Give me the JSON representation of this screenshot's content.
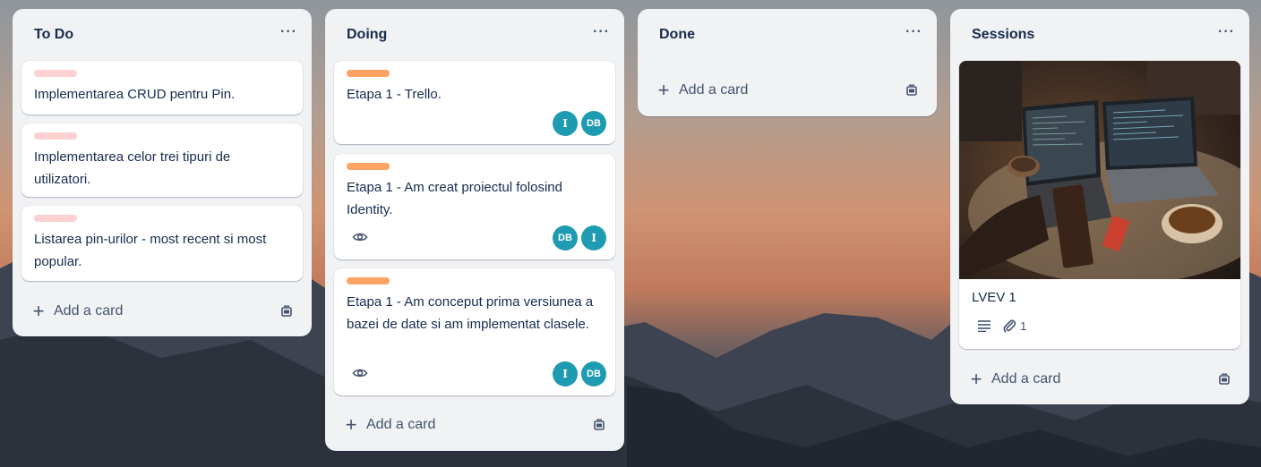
{
  "board": {
    "lists": [
      {
        "title": "To Do",
        "menu": "···",
        "cards": [
          {
            "text": "Implementarea CRUD pentru Pin.",
            "label_color": "#fdd0d2"
          },
          {
            "text": "Implementarea celor trei tipuri de utilizatori.",
            "label_color": "#fdd0d2"
          },
          {
            "text": "Listarea pin-urilor - most recent si most popular.",
            "label_color": "#fdd0d2"
          }
        ],
        "add_label": "Add a card"
      },
      {
        "title": "Doing",
        "menu": "···",
        "cards": [
          {
            "text": "Etapa 1 - Trello.",
            "label_color": "#fea362",
            "members": [
              "I",
              "DB"
            ]
          },
          {
            "text": "Etapa 1 - Am creat proiectul folosind Identity.",
            "label_color": "#fea362",
            "watching": true,
            "members": [
              "DB",
              "I"
            ]
          },
          {
            "text": "Etapa 1 - Am conceput prima versiunea a bazei de date si am implementat clasele.",
            "label_color": "#fea362",
            "watching": true,
            "members": [
              "I",
              "DB"
            ]
          }
        ],
        "add_label": "Add a card"
      },
      {
        "title": "Done",
        "menu": "···",
        "cards": [],
        "add_label": "Add a card"
      },
      {
        "title": "Sessions",
        "menu": "···",
        "cards": [
          {
            "text": "LVEV 1",
            "has_cover": true,
            "has_description": true,
            "attachments": "1"
          }
        ],
        "add_label": "Add a card"
      }
    ]
  },
  "colors": {
    "list_bg": "#f1f2f4",
    "avatar_bg": "#1e9bb0",
    "label_pink": "#fdd0d2",
    "label_orange": "#fea362"
  },
  "icons": {
    "menu": "ellipsis-icon",
    "add": "plus-icon",
    "template": "card-template-icon",
    "watch": "eye-icon",
    "description": "description-lines-icon",
    "attachment": "paperclip-icon"
  }
}
